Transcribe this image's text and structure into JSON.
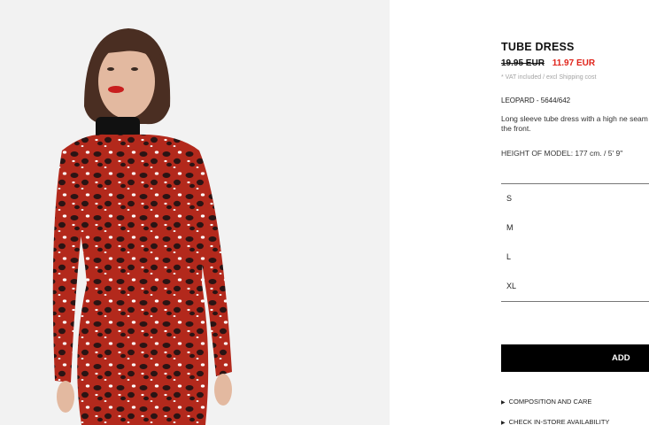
{
  "product": {
    "name": "TUBE DRESS",
    "old_price": "19.95 EUR",
    "new_price": "11.97 EUR",
    "vat_note": "* VAT included / excl Shipping cost",
    "color_ref": "LEOPARD - 5644/642",
    "description": "Long sleeve tube dress with a high ne seam down the front.",
    "model_height": "HEIGHT OF MODEL: 177 cm. / 5' 9\""
  },
  "sizes": [
    "S",
    "M",
    "L",
    "XL"
  ],
  "actions": {
    "add_label": "ADD"
  },
  "links": {
    "composition": "COMPOSITION AND CARE",
    "check_store": "CHECK IN-STORE AVAILABILITY"
  },
  "colors": {
    "price_red": "#e0241b",
    "dress_red": "#b3291c",
    "button_black": "#000000"
  }
}
